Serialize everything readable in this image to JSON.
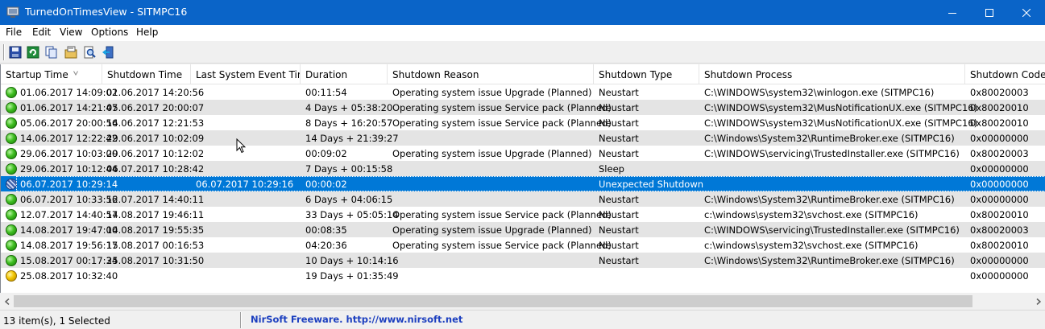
{
  "window": {
    "title": "TurnedOnTimesView  -  SITMPC16",
    "controls": [
      "minimize-icon",
      "maximize-icon",
      "close-icon"
    ]
  },
  "menu": [
    "File",
    "Edit",
    "View",
    "Options",
    "Help"
  ],
  "toolbar": [
    "save-icon",
    "refresh-icon",
    "copy-icon",
    "properties-icon",
    "find-icon",
    "exit-icon"
  ],
  "columns": [
    "Startup Time",
    "Shutdown Time",
    "Last System Event Time",
    "Duration",
    "Shutdown Reason",
    "Shutdown Type",
    "Shutdown Process",
    "Shutdown Code"
  ],
  "sort": {
    "column": "Startup Time",
    "direction": "ascending"
  },
  "rows": [
    {
      "status": "green",
      "startup": "01.06.2017 14:09:02",
      "shutdown": "01.06.2017 14:20:56",
      "last_event": "",
      "duration": "00:11:54",
      "reason": "Operating system issue Upgrade (Planned)",
      "type": "Neustart",
      "process": "C:\\WINDOWS\\system32\\winlogon.exe (SITMPC16)",
      "code": "0x80020003"
    },
    {
      "status": "green",
      "startup": "01.06.2017 14:21:47",
      "shutdown": "05.06.2017 20:00:07",
      "last_event": "",
      "duration": "4 Days + 05:38:20",
      "reason": "Operating system issue Service pack (Planned)",
      "type": "Neustart",
      "process": "C:\\WINDOWS\\system32\\MusNotificationUX.exe (SITMPC16)",
      "code": "0x80020010"
    },
    {
      "status": "green",
      "startup": "05.06.2017 20:00:56",
      "shutdown": "14.06.2017 12:21:53",
      "last_event": "",
      "duration": "8 Days + 16:20:57",
      "reason": "Operating system issue Service pack (Planned)",
      "type": "Neustart",
      "process": "C:\\WINDOWS\\system32\\MusNotificationUX.exe (SITMPC16)",
      "code": "0x80020010"
    },
    {
      "status": "green",
      "startup": "14.06.2017 12:22:42",
      "shutdown": "29.06.2017 10:02:09",
      "last_event": "",
      "duration": "14 Days + 21:39:27",
      "reason": "",
      "type": "Neustart",
      "process": "C:\\Windows\\System32\\RuntimeBroker.exe (SITMPC16)",
      "code": "0x00000000"
    },
    {
      "status": "green",
      "startup": "29.06.2017 10:03:00",
      "shutdown": "29.06.2017 10:12:02",
      "last_event": "",
      "duration": "00:09:02",
      "reason": "Operating system issue Upgrade (Planned)",
      "type": "Neustart",
      "process": "C:\\WINDOWS\\servicing\\TrustedInstaller.exe (SITMPC16)",
      "code": "0x80020003"
    },
    {
      "status": "green",
      "startup": "29.06.2017 10:12:44",
      "shutdown": "06.07.2017 10:28:42",
      "last_event": "",
      "duration": "7 Days + 00:15:58",
      "reason": "",
      "type": "Sleep",
      "process": "",
      "code": "0x00000000"
    },
    {
      "status": "blue",
      "startup": "06.07.2017 10:29:14",
      "shutdown": "",
      "last_event": "06.07.2017 10:29:16",
      "duration": "00:00:02",
      "reason": "",
      "type": "Unexpected Shutdown",
      "process": "",
      "code": "0x00000000",
      "selected": true
    },
    {
      "status": "green",
      "startup": "06.07.2017 10:33:56",
      "shutdown": "12.07.2017 14:40:11",
      "last_event": "",
      "duration": "6 Days + 04:06:15",
      "reason": "",
      "type": "Neustart",
      "process": "C:\\Windows\\System32\\RuntimeBroker.exe (SITMPC16)",
      "code": "0x00000000"
    },
    {
      "status": "green",
      "startup": "12.07.2017 14:40:57",
      "shutdown": "14.08.2017 19:46:11",
      "last_event": "",
      "duration": "33 Days + 05:05:14",
      "reason": "Operating system issue Service pack (Planned)",
      "type": "Neustart",
      "process": "c:\\windows\\system32\\svchost.exe (SITMPC16)",
      "code": "0x80020010"
    },
    {
      "status": "green",
      "startup": "14.08.2017 19:47:00",
      "shutdown": "14.08.2017 19:55:35",
      "last_event": "",
      "duration": "00:08:35",
      "reason": "Operating system issue Upgrade (Planned)",
      "type": "Neustart",
      "process": "C:\\WINDOWS\\servicing\\TrustedInstaller.exe (SITMPC16)",
      "code": "0x80020003"
    },
    {
      "status": "green",
      "startup": "14.08.2017 19:56:17",
      "shutdown": "15.08.2017 00:16:53",
      "last_event": "",
      "duration": "04:20:36",
      "reason": "Operating system issue Service pack (Planned)",
      "type": "Neustart",
      "process": "c:\\windows\\system32\\svchost.exe (SITMPC16)",
      "code": "0x80020010"
    },
    {
      "status": "green",
      "startup": "15.08.2017 00:17:34",
      "shutdown": "25.08.2017 10:31:50",
      "last_event": "",
      "duration": "10 Days + 10:14:16",
      "reason": "",
      "type": "Neustart",
      "process": "C:\\Windows\\System32\\RuntimeBroker.exe (SITMPC16)",
      "code": "0x00000000"
    },
    {
      "status": "yellow",
      "startup": "25.08.2017 10:32:40",
      "shutdown": "",
      "last_event": "",
      "duration": "19 Days + 01:35:49",
      "reason": "",
      "type": "",
      "process": "",
      "code": "0x00000000"
    }
  ],
  "statusbar": {
    "count": "13 item(s), 1 Selected",
    "link": "NirSoft Freeware.  http://www.nirsoft.net"
  },
  "colors": {
    "title_bar": "#0a64c8",
    "selection": "#0078d7",
    "alt_row": "#e4e4e4",
    "link": "#1c3fbf"
  }
}
